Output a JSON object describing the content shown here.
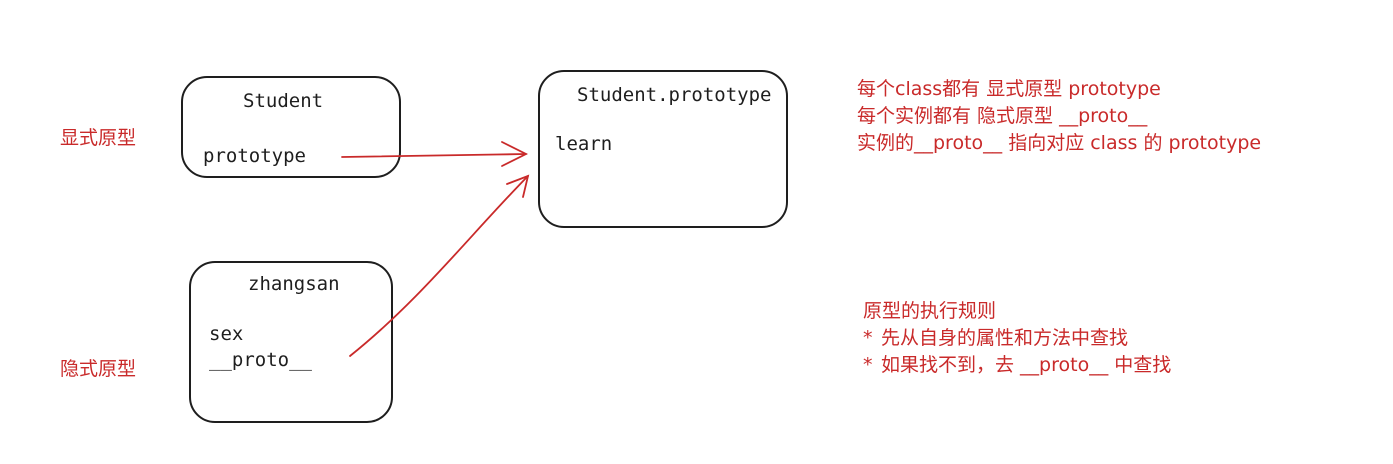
{
  "labels": {
    "explicit": "显式原型",
    "implicit": "隐式原型"
  },
  "student_box": {
    "title": "Student",
    "field": "prototype"
  },
  "prototype_box": {
    "title": "Student.prototype",
    "field": "learn"
  },
  "instance_box": {
    "title": "zhangsan",
    "fields": [
      "sex",
      "__proto__"
    ]
  },
  "notes": {
    "lines": [
      "每个class都有 显式原型 prototype",
      "每个实例都有 隐式原型 __proto__",
      "实例的__proto__ 指向对应 class 的 prototype"
    ]
  },
  "rules": {
    "heading": "原型的执行规则",
    "bullet_symbol": "*",
    "items": [
      "先从自身的属性和方法中查找",
      "如果找不到，去 __proto__ 中查找"
    ]
  },
  "colors": {
    "ink": "#1e1e1e",
    "accent": "#c92a2a"
  }
}
